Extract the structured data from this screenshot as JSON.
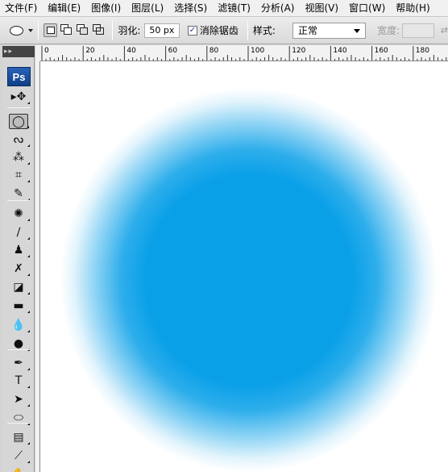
{
  "menu": [
    "文件(F)",
    "编辑(E)",
    "图像(I)",
    "图层(L)",
    "选择(S)",
    "滤镜(T)",
    "分析(A)",
    "视图(V)",
    "窗口(W)",
    "帮助(H)"
  ],
  "options": {
    "tool_preset_icon": "ellipse-marquee-icon",
    "feather_label": "羽化:",
    "feather_value": "50 px",
    "antialias_label": "消除锯齿",
    "antialias_checked": true,
    "style_label": "样式:",
    "style_value": "正常",
    "width_label": "宽度:"
  },
  "toolbox": {
    "logo": "Ps",
    "tools": [
      {
        "name": "move-tool-icon",
        "glyph": "▸✥",
        "active": false
      },
      {
        "name": "elliptical-marquee-icon",
        "glyph": "◯",
        "active": true
      },
      {
        "name": "lasso-icon",
        "glyph": "ᔓ",
        "active": false
      },
      {
        "name": "magic-wand-icon",
        "glyph": "⁂",
        "active": false
      },
      {
        "name": "crop-icon",
        "glyph": "⌗",
        "active": false
      },
      {
        "name": "eyedropper-icon",
        "glyph": "✎",
        "active": false
      },
      {
        "name": "healing-brush-icon",
        "glyph": "✺",
        "active": false
      },
      {
        "name": "brush-icon",
        "glyph": "∕",
        "active": false
      },
      {
        "name": "clone-stamp-icon",
        "glyph": "♟",
        "active": false
      },
      {
        "name": "history-brush-icon",
        "glyph": "✗",
        "active": false
      },
      {
        "name": "eraser-icon",
        "glyph": "◪",
        "active": false
      },
      {
        "name": "gradient-icon",
        "glyph": "▬",
        "active": false
      },
      {
        "name": "blur-icon",
        "glyph": "💧",
        "active": false
      },
      {
        "name": "dodge-icon",
        "glyph": "●",
        "active": false
      },
      {
        "name": "pen-icon",
        "glyph": "✒",
        "active": false
      },
      {
        "name": "type-icon",
        "glyph": "T",
        "active": false
      },
      {
        "name": "path-selection-icon",
        "glyph": "➤",
        "active": false
      },
      {
        "name": "ellipse-shape-icon",
        "glyph": "⬭",
        "active": false
      },
      {
        "name": "notes-icon",
        "glyph": "▤",
        "active": false
      },
      {
        "name": "eyedropper-2-icon",
        "glyph": "⟋",
        "active": false
      },
      {
        "name": "hand-icon",
        "glyph": "✋",
        "active": false
      }
    ]
  },
  "ruler": {
    "labels": [
      "0",
      "20",
      "40",
      "60",
      "80",
      "100",
      "120",
      "140",
      "160",
      "180"
    ]
  },
  "canvas": {
    "background_color": "#ffffff",
    "blob_color": "#0aa0e8",
    "blob_feather": "50 px"
  }
}
